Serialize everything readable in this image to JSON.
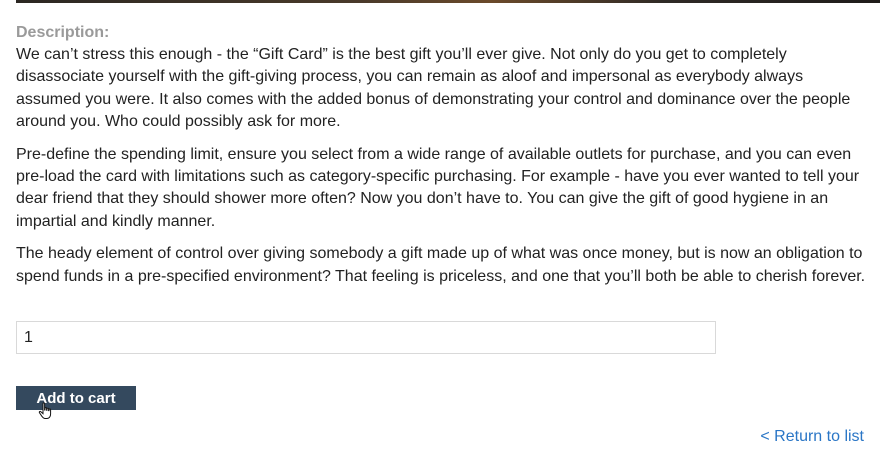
{
  "description": {
    "label": "Description:",
    "paragraphs": [
      "We can’t stress this enough - the “Gift Card” is the best gift you’ll ever give. Not only do you get to completely disassociate yourself with the gift-giving process, you can remain as aloof and impersonal as everybody always assumed you were. It also comes with the added bonus of demonstrating your control and dominance over the people around you. Who could possibly ask for more.",
      "Pre-define the spending limit, ensure you select from a wide range of available outlets for purchase, and you can even pre-load the card with limitations such as category-specific purchasing. For example - have you ever wanted to tell your dear friend that they should shower more often? Now you don’t have to. You can give the gift of good hygiene in an impartial and kindly manner.",
      "The heady element of control over giving somebody a gift made up of what was once money, but is now an obligation to spend funds in a pre-specified environment? That feeling is priceless, and one that you’ll both be able to cherish forever."
    ]
  },
  "quantity": {
    "value": "1"
  },
  "cart": {
    "add_label": "Add to cart"
  },
  "navigation": {
    "return_label": "< Return to list"
  },
  "colors": {
    "button_bg": "#34495e",
    "link": "#2a76c6",
    "label": "#9a9a9a"
  },
  "icons": {
    "cursor": "hand-pointer-icon"
  }
}
